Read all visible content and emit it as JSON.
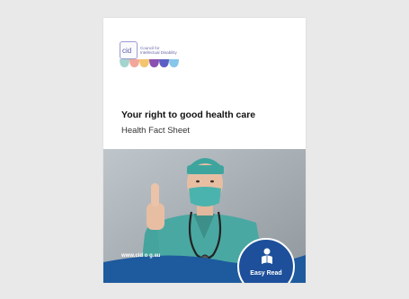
{
  "document": {
    "org_line1": "Council for",
    "org_line2": "Intellectual Disability",
    "title": "Your right to good health care",
    "subtitle": "Health Fact Sheet",
    "website": "www.cid o g.au",
    "badge_label": "Easy Read"
  },
  "logo": {
    "icon": "cid-logo-icon",
    "scallop_colors": [
      "#a4d4ce",
      "#f2a79a",
      "#f3c56c",
      "#8a4fb0",
      "#5b5fc4",
      "#86c6e8"
    ]
  },
  "photo": {
    "icon": "doctor-thumbs-up-photo",
    "accent_color": "#1d5a9e"
  }
}
